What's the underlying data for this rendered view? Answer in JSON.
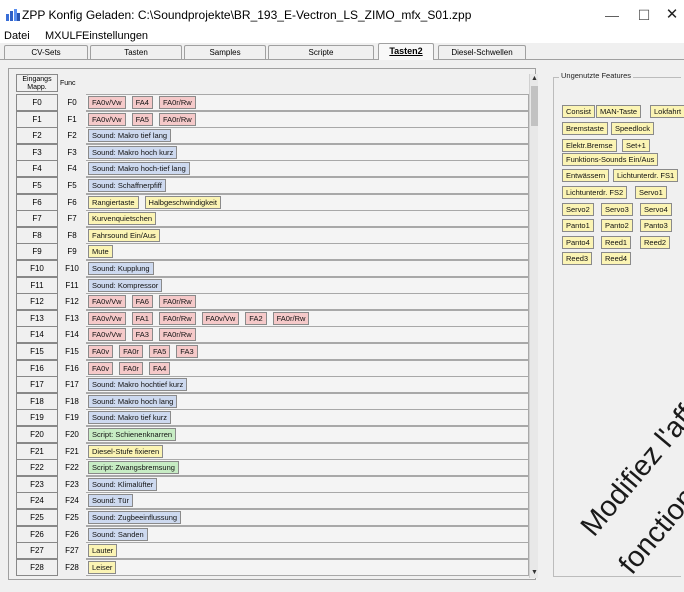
{
  "window": {
    "title": "ZPP Konfig   Geladen: C:\\Soundprojekte\\BR_193_E-Vectron_LS_ZIMO_mfx_S01.zpp",
    "minimize_glyph": "—",
    "maximize_glyph": "☐",
    "close_glyph": "✕",
    "icon": "app-icon"
  },
  "menu": {
    "items": [
      "Datei",
      "MXULF",
      "Einstellungen"
    ]
  },
  "tabs": [
    "CV-Sets",
    "Tasten",
    "Samples",
    "Scripte",
    "Tasten2",
    "Diesel-Schwellen"
  ],
  "active_tab": "Tasten2",
  "grid": {
    "header_mapping": "Eingangs\nMapp.",
    "header_func": "Func",
    "rows": [
      {
        "input": "F0",
        "func": "F0",
        "chips": [
          {
            "label": "FA0v/Vw",
            "color": "red"
          },
          {
            "label": "FA4",
            "color": "red"
          },
          {
            "label": "FA0r/Rw",
            "color": "red"
          }
        ]
      },
      {
        "input": "F1",
        "func": "F1",
        "chips": [
          {
            "label": "FA0v/Vw",
            "color": "red"
          },
          {
            "label": "FA5",
            "color": "red"
          },
          {
            "label": "FA0r/Rw",
            "color": "red"
          }
        ]
      },
      {
        "input": "F2",
        "func": "F2",
        "chips": [
          {
            "label": "Sound: Makro tief lang",
            "color": "blue"
          }
        ]
      },
      {
        "input": "F3",
        "func": "F3",
        "chips": [
          {
            "label": "Sound: Makro hoch kurz",
            "color": "blue"
          }
        ]
      },
      {
        "input": "F4",
        "func": "F4",
        "chips": [
          {
            "label": "Sound: Makro hoch-tief lang",
            "color": "blue"
          }
        ]
      },
      {
        "input": "F5",
        "func": "F5",
        "chips": [
          {
            "label": "Sound: Schaffnerpfiff",
            "color": "blue"
          }
        ]
      },
      {
        "input": "F6",
        "func": "F6",
        "chips": [
          {
            "label": "Rangiertaste",
            "color": "yellow"
          },
          {
            "label": "Halbgeschwindigkeit",
            "color": "yellow"
          }
        ]
      },
      {
        "input": "F7",
        "func": "F7",
        "chips": [
          {
            "label": "Kurvenquietschen",
            "color": "yellow"
          }
        ]
      },
      {
        "input": "F8",
        "func": "F8",
        "chips": [
          {
            "label": "Fahrsound Ein/Aus",
            "color": "yellow"
          }
        ]
      },
      {
        "input": "F9",
        "func": "F9",
        "chips": [
          {
            "label": "Mute",
            "color": "yellow"
          }
        ]
      },
      {
        "input": "F10",
        "func": "F10",
        "chips": [
          {
            "label": "Sound: Kupplung",
            "color": "blue"
          }
        ]
      },
      {
        "input": "F11",
        "func": "F11",
        "chips": [
          {
            "label": "Sound: Kompressor",
            "color": "blue"
          }
        ]
      },
      {
        "input": "F12",
        "func": "F12",
        "chips": [
          {
            "label": "FA0v/Vw",
            "color": "red"
          },
          {
            "label": "FA6",
            "color": "red"
          },
          {
            "label": "FA0r/Rw",
            "color": "red"
          }
        ]
      },
      {
        "input": "F13",
        "func": "F13",
        "chips": [
          {
            "label": "FA0v/Vw",
            "color": "red"
          },
          {
            "label": "FA1",
            "color": "red"
          },
          {
            "label": "FA0r/Rw",
            "color": "red"
          },
          {
            "label": "FA0v/Vw",
            "color": "red"
          },
          {
            "label": "FA2",
            "color": "red"
          },
          {
            "label": "FA0r/Rw",
            "color": "red"
          }
        ]
      },
      {
        "input": "F14",
        "func": "F14",
        "chips": [
          {
            "label": "FA0v/Vw",
            "color": "red"
          },
          {
            "label": "FA3",
            "color": "red"
          },
          {
            "label": "FA0r/Rw",
            "color": "red"
          }
        ]
      },
      {
        "input": "F15",
        "func": "F15",
        "chips": [
          {
            "label": "FA0v",
            "color": "red"
          },
          {
            "label": "FA0r",
            "color": "red"
          },
          {
            "label": "FA5",
            "color": "red"
          },
          {
            "label": "FA3",
            "color": "red"
          }
        ]
      },
      {
        "input": "F16",
        "func": "F16",
        "chips": [
          {
            "label": "FA0v",
            "color": "red"
          },
          {
            "label": "FA0r",
            "color": "red"
          },
          {
            "label": "FA4",
            "color": "red"
          }
        ]
      },
      {
        "input": "F17",
        "func": "F17",
        "chips": [
          {
            "label": "Sound: Makro hochtief kurz",
            "color": "blue"
          }
        ]
      },
      {
        "input": "F18",
        "func": "F18",
        "chips": [
          {
            "label": "Sound: Makro hoch lang",
            "color": "blue"
          }
        ]
      },
      {
        "input": "F19",
        "func": "F19",
        "chips": [
          {
            "label": "Sound: Makro tief kurz",
            "color": "blue"
          }
        ]
      },
      {
        "input": "F20",
        "func": "F20",
        "chips": [
          {
            "label": "Script: Schienenknarren",
            "color": "green"
          }
        ]
      },
      {
        "input": "F21",
        "func": "F21",
        "chips": [
          {
            "label": "Diesel-Stufe fixieren",
            "color": "yellow"
          }
        ]
      },
      {
        "input": "F22",
        "func": "F22",
        "chips": [
          {
            "label": "Script: Zwangsbremsung",
            "color": "green"
          }
        ]
      },
      {
        "input": "F23",
        "func": "F23",
        "chips": [
          {
            "label": "Sound: Klimalüfter",
            "color": "blue"
          }
        ]
      },
      {
        "input": "F24",
        "func": "F24",
        "chips": [
          {
            "label": "Sound: Tür",
            "color": "blue"
          }
        ]
      },
      {
        "input": "F25",
        "func": "F25",
        "chips": [
          {
            "label": "Sound: Zugbeeinflussung",
            "color": "blue"
          }
        ]
      },
      {
        "input": "F26",
        "func": "F26",
        "chips": [
          {
            "label": "Sound: Sanden",
            "color": "blue"
          }
        ]
      },
      {
        "input": "F27",
        "func": "F27",
        "chips": [
          {
            "label": "Lauter",
            "color": "yellow"
          }
        ]
      },
      {
        "input": "F28",
        "func": "F28",
        "chips": [
          {
            "label": "Leiser",
            "color": "yellow"
          }
        ]
      }
    ]
  },
  "unused_features": {
    "title": "Ungenutzte Features",
    "items": [
      "Consist",
      "MAN-Taste",
      "Lokfahrt",
      "Bremstaste",
      "Speedlock",
      "Elektr.Bremse",
      "Set+1",
      "Funktions-Sounds Ein/Aus",
      "Entwässern",
      "Lichtunterdr. FS1",
      "Lichtunterdr. FS2",
      "Servo1",
      "Servo2",
      "Servo3",
      "Servo4",
      "Panto1",
      "Panto2",
      "Panto3",
      "Panto4",
      "Reed1",
      "Reed2",
      "Reed3",
      "Reed4"
    ]
  },
  "watermark": {
    "line1": "Modifiez l'affectation",
    "line2": "fonctions, ajoutez"
  },
  "scrollbar": {
    "up_glyph": "▲",
    "down_glyph": "▼"
  },
  "colors": {
    "red": "#f5c9c9",
    "blue": "#cdd9ef",
    "yellow": "#fbf4b4",
    "green": "#c7ecc4"
  }
}
